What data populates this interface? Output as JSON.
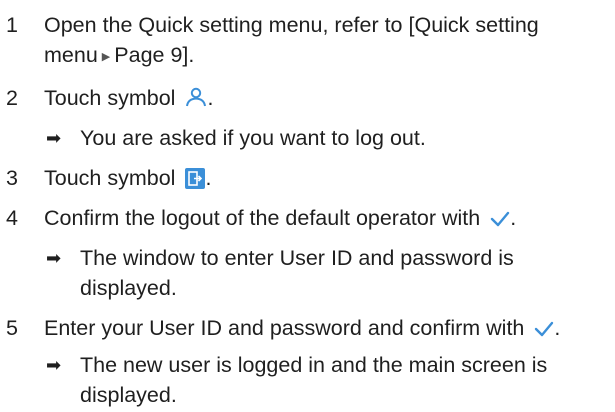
{
  "steps": [
    {
      "number": "1",
      "line1": "Open the Quick setting menu, refer to [Quick setting",
      "line2_a": "menu",
      "line2_b": "Page 9]."
    },
    {
      "number": "2",
      "text": "Touch symbol",
      "end": ".",
      "icon": "user-icon",
      "result": "You are asked if you want to log out."
    },
    {
      "number": "3",
      "text": "Touch symbol",
      "end": ".",
      "icon": "logout-icon"
    },
    {
      "number": "4",
      "text": "Confirm the logout of the default operator with",
      "end": ".",
      "icon": "checkmark-icon",
      "result_line1": "The window to enter User ID and password is",
      "result_line2": "displayed."
    },
    {
      "number": "5",
      "text": "Enter your User ID and password and confirm with",
      "end": ".",
      "icon": "checkmark-icon",
      "result_line1": "The new user is logged in and the main screen is",
      "result_line2": "displayed."
    }
  ],
  "glyphs": {
    "result_arrow": "➡",
    "link_triangle": "▶"
  },
  "colors": {
    "accent": "#3b8fd8",
    "text": "#1f1f1f"
  }
}
